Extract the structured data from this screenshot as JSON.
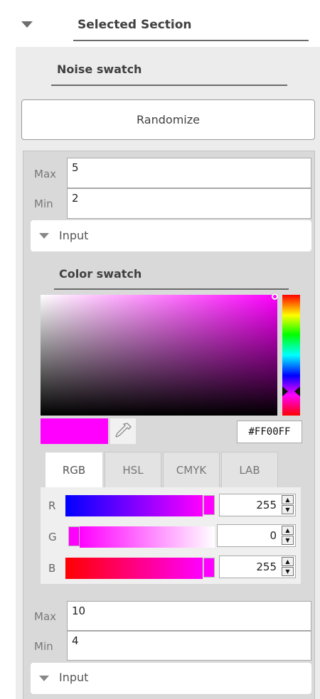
{
  "header": {
    "title": "Selected Section"
  },
  "noise": {
    "title": "Noise swatch",
    "randomize_label": "Randomize",
    "max_label": "Max",
    "max_value": "5",
    "min_label": "Min",
    "min_value": "2",
    "input_label": "Input"
  },
  "color": {
    "title": "Color swatch",
    "hex": "#FF00FF",
    "current_color": "#ff00ff",
    "tabs": [
      "RGB",
      "HSL",
      "CMYK",
      "LAB"
    ],
    "active_tab": "RGB",
    "channels": [
      {
        "label": "R",
        "value": "255"
      },
      {
        "label": "G",
        "value": "0"
      },
      {
        "label": "B",
        "value": "255"
      }
    ]
  },
  "second": {
    "max_label": "Max",
    "max_value": "10",
    "min_label": "Min",
    "min_value": "4",
    "input_label": "Input"
  },
  "icons": {
    "section_toggle": "triangle-down-icon",
    "eyedropper": "eyedropper-icon",
    "spin_up": "spin-up-icon",
    "spin_down": "spin-down-icon"
  }
}
